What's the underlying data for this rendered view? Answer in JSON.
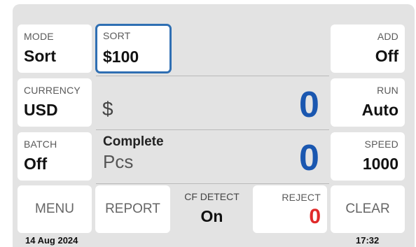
{
  "mode": {
    "label": "MODE",
    "value": "Sort"
  },
  "sort": {
    "label": "SORT",
    "value": "$100"
  },
  "add": {
    "label": "ADD",
    "value": "Off"
  },
  "currency": {
    "label": "CURRENCY",
    "value": "USD"
  },
  "run": {
    "label": "RUN",
    "value": "Auto"
  },
  "batch": {
    "label": "BATCH",
    "value": "Off"
  },
  "speed": {
    "label": "SPEED",
    "value": "1000"
  },
  "display": {
    "currency_symbol": "$",
    "amount": "0",
    "status": "Complete",
    "unit": "Pcs",
    "count": "0"
  },
  "buttons": {
    "menu": "MENU",
    "report": "REPORT",
    "clear": "CLEAR"
  },
  "cf_detect": {
    "label": "CF DETECT",
    "value": "On"
  },
  "reject": {
    "label": "REJECT",
    "value": "0"
  },
  "footer": {
    "date": "14 Aug 2024",
    "time": "17:32"
  },
  "colors": {
    "accent": "#2f6fb3",
    "count_blue": "#1a57b0",
    "reject_red": "#e02a2a",
    "panel": "#e3e3e3"
  }
}
